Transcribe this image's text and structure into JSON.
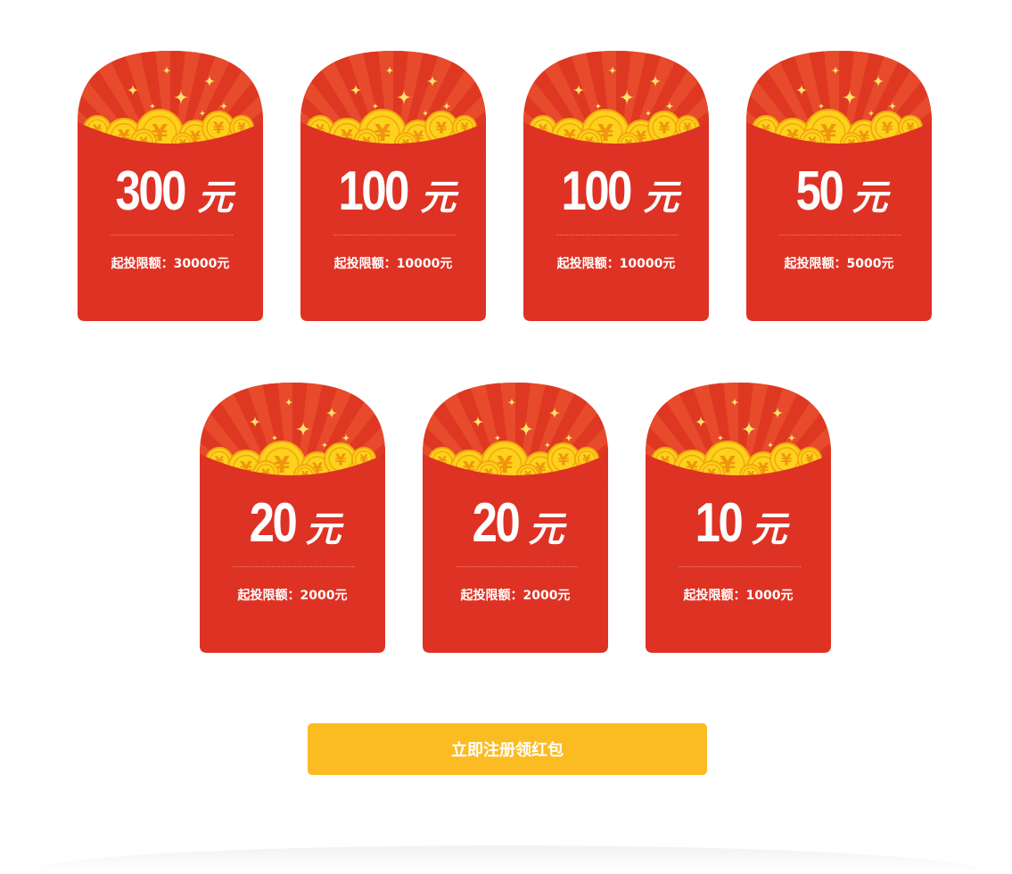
{
  "envelopes": [
    {
      "amount": "300",
      "unit": "元",
      "limit": "起投限额：30000元"
    },
    {
      "amount": "100",
      "unit": "元",
      "limit": "起投限额：10000元"
    },
    {
      "amount": "100",
      "unit": "元",
      "limit": "起投限额：10000元"
    },
    {
      "amount": "50",
      "unit": "元",
      "limit": "起投限额：5000元"
    },
    {
      "amount": "20",
      "unit": "元",
      "limit": "起投限额：2000元"
    },
    {
      "amount": "20",
      "unit": "元",
      "limit": "起投限额：2000元"
    },
    {
      "amount": "10",
      "unit": "元",
      "limit": "起投限额：1000元"
    }
  ],
  "cta": {
    "label": "立即注册领红包"
  },
  "colors": {
    "envelope_red": "#de3224",
    "envelope_top": "#e84a2c",
    "coin_gold": "#fcd21c",
    "button_yellow": "#fbbb23"
  },
  "icons": {
    "coin": "yuan-coin-icon",
    "sparkle": "star-sparkle-icon"
  }
}
